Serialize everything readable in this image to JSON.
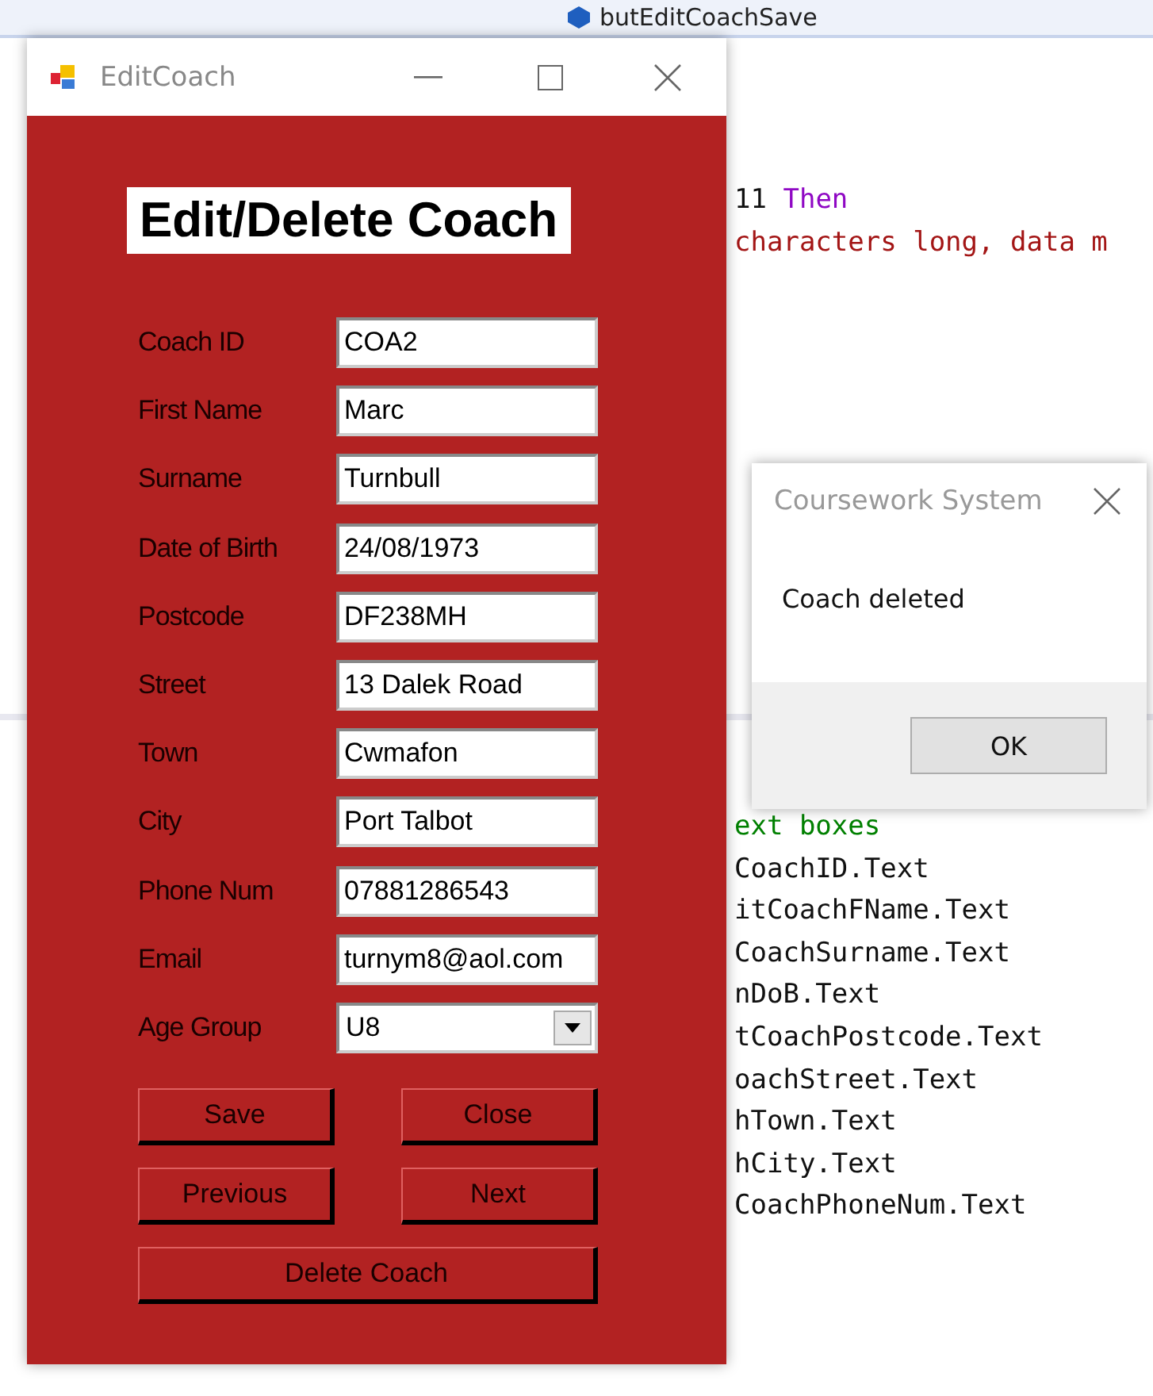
{
  "editor": {
    "member_dropdown": "butEditCoachSave",
    "upper_lines": [
      [
        {
          "kind": "number",
          "text": "11 "
        },
        {
          "kind": "keyword",
          "text": "Then"
        }
      ],
      [
        {
          "kind": "string",
          "text": "characters long, data m"
        }
      ]
    ],
    "lower_lines": [
      [
        {
          "kind": "comment",
          "text": "ext boxes"
        }
      ],
      [
        {
          "kind": "plain",
          "text": "CoachID.Text"
        }
      ],
      [
        {
          "kind": "plain",
          "text": "itCoachFName.Text"
        }
      ],
      [
        {
          "kind": "plain",
          "text": "CoachSurname.Text"
        }
      ],
      [
        {
          "kind": "plain",
          "text": "nDoB.Text"
        }
      ],
      [
        {
          "kind": "plain",
          "text": "tCoachPostcode.Text"
        }
      ],
      [
        {
          "kind": "plain",
          "text": "oachStreet.Text"
        }
      ],
      [
        {
          "kind": "plain",
          "text": "hTown.Text"
        }
      ],
      [
        {
          "kind": "plain",
          "text": "hCity.Text"
        }
      ],
      [
        {
          "kind": "plain",
          "text": "CoachPhoneNum.Text"
        }
      ]
    ]
  },
  "window": {
    "title": "EditCoach",
    "heading": "Edit/Delete Coach",
    "fields": [
      {
        "label": "Coach ID",
        "value": "COA2"
      },
      {
        "label": "First Name",
        "value": "Marc"
      },
      {
        "label": "Surname",
        "value": "Turnbull"
      },
      {
        "label": "Date of Birth",
        "value": "24/08/1973"
      },
      {
        "label": "Postcode",
        "value": "DF238MH"
      },
      {
        "label": "Street",
        "value": "13 Dalek Road"
      },
      {
        "label": "Town",
        "value": "Cwmafon"
      },
      {
        "label": "City",
        "value": "Port Talbot"
      },
      {
        "label": "Phone Num",
        "value": "07881286543"
      },
      {
        "label": "Email",
        "value": "turnym8@aol.com"
      }
    ],
    "age_group": {
      "label": "Age Group",
      "value": "U8"
    },
    "buttons": [
      "Save",
      "Close",
      "Previous",
      "Next"
    ],
    "delete_button": "Delete Coach"
  },
  "dialog": {
    "title": "Coursework System",
    "message": "Coach deleted",
    "button": "OK"
  }
}
